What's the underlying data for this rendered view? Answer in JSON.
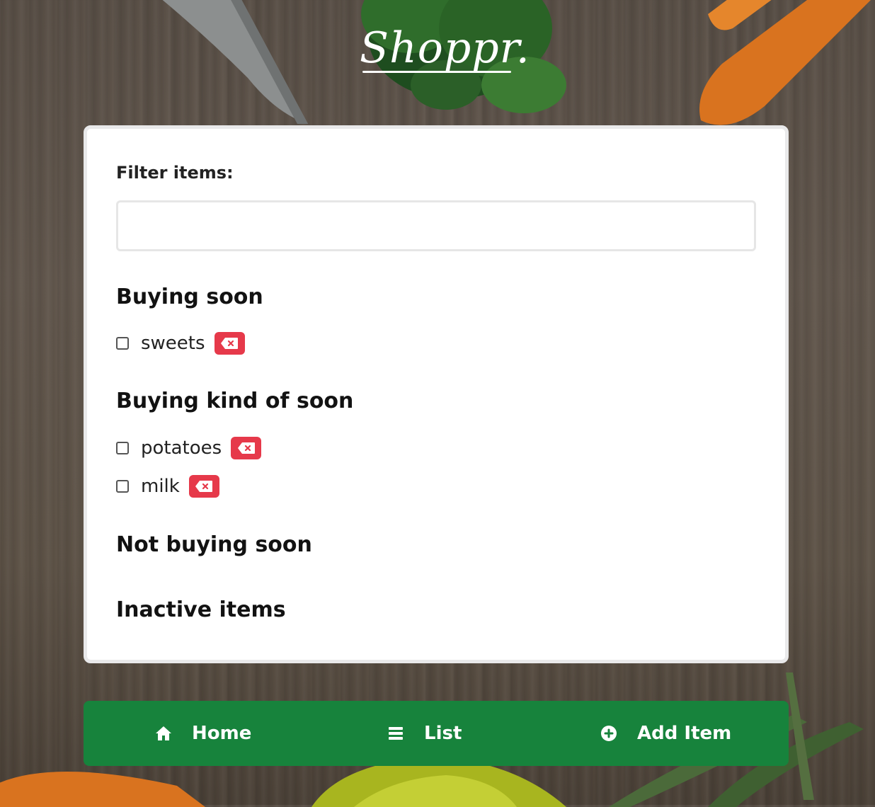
{
  "app": {
    "logo_text": "Shoppr."
  },
  "filter": {
    "label": "Filter items:",
    "value": "",
    "placeholder": ""
  },
  "sections": [
    {
      "title": "Buying soon",
      "items": [
        {
          "label": "sweets",
          "checked": false
        }
      ]
    },
    {
      "title": "Buying kind of soon",
      "items": [
        {
          "label": "potatoes",
          "checked": false
        },
        {
          "label": "milk",
          "checked": false
        }
      ]
    },
    {
      "title": "Not buying soon",
      "items": []
    },
    {
      "title": "Inactive items",
      "items": []
    }
  ],
  "nav": [
    {
      "label": "Home",
      "icon": "home-icon"
    },
    {
      "label": "List",
      "icon": "list-icon"
    },
    {
      "label": "Add Item",
      "icon": "plus-circle-icon"
    }
  ],
  "colors": {
    "nav_bg": "#17833c",
    "delete_btn": "#e6394a",
    "card_bg": "#ffffff"
  }
}
